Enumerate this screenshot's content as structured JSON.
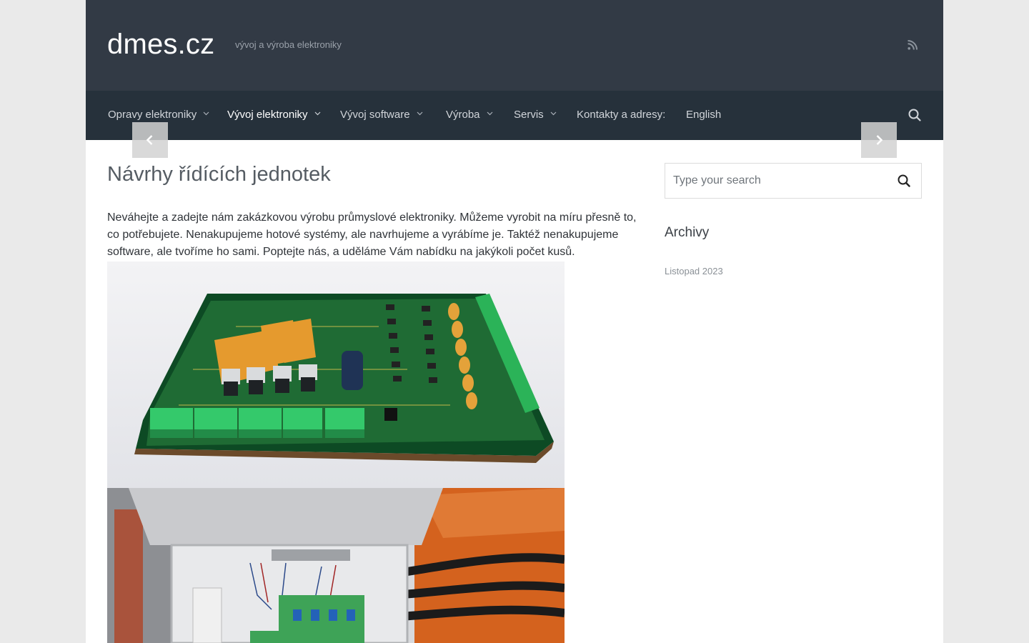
{
  "site": {
    "title": "dmes.cz",
    "tagline": "vývoj a výroba elektroniky"
  },
  "header": {
    "icon": "rss-icon"
  },
  "nav": {
    "items": [
      {
        "label": "Opravy elektroniky",
        "has_submenu": true,
        "active": false
      },
      {
        "label": "Vývoj elektroniky",
        "has_submenu": true,
        "active": true
      },
      {
        "label": "Vývoj software",
        "has_submenu": true,
        "active": false
      },
      {
        "label": "Výroba",
        "has_submenu": true,
        "active": false
      },
      {
        "label": "Servis",
        "has_submenu": true,
        "active": false
      },
      {
        "label": "Kontakty a adresy:",
        "has_submenu": false,
        "active": false
      },
      {
        "label": "English",
        "has_submenu": false,
        "active": false
      }
    ],
    "search_icon": "search-icon"
  },
  "slider": {
    "prev_icon": "chevron-left-icon",
    "next_icon": "chevron-right-icon"
  },
  "post": {
    "title": "Návrhy řídících jednotek",
    "body": "Neváhejte a zadejte nám zakázkovou výrobu průmyslové elektroniky. Můžeme vyrobit na míru přesně to, co potřebujete. Nenakupujeme hotové systémy, ale navrhujeme a vyrábíme je. Taktéž nenakupujeme software, ale tvoříme ho sami. Poptejte nás, a uděláme Vám nabídku na jakýkoli počet kusů."
  },
  "sidebar": {
    "search": {
      "placeholder": "Type your search",
      "value": ""
    },
    "archives": {
      "title": "Archivy",
      "items": [
        "Listopad 2023"
      ]
    }
  },
  "colors": {
    "header_bg": "#323a45",
    "nav_bg": "#26313b",
    "page_bg": "#eaeaea",
    "content_bg": "#ffffff"
  }
}
